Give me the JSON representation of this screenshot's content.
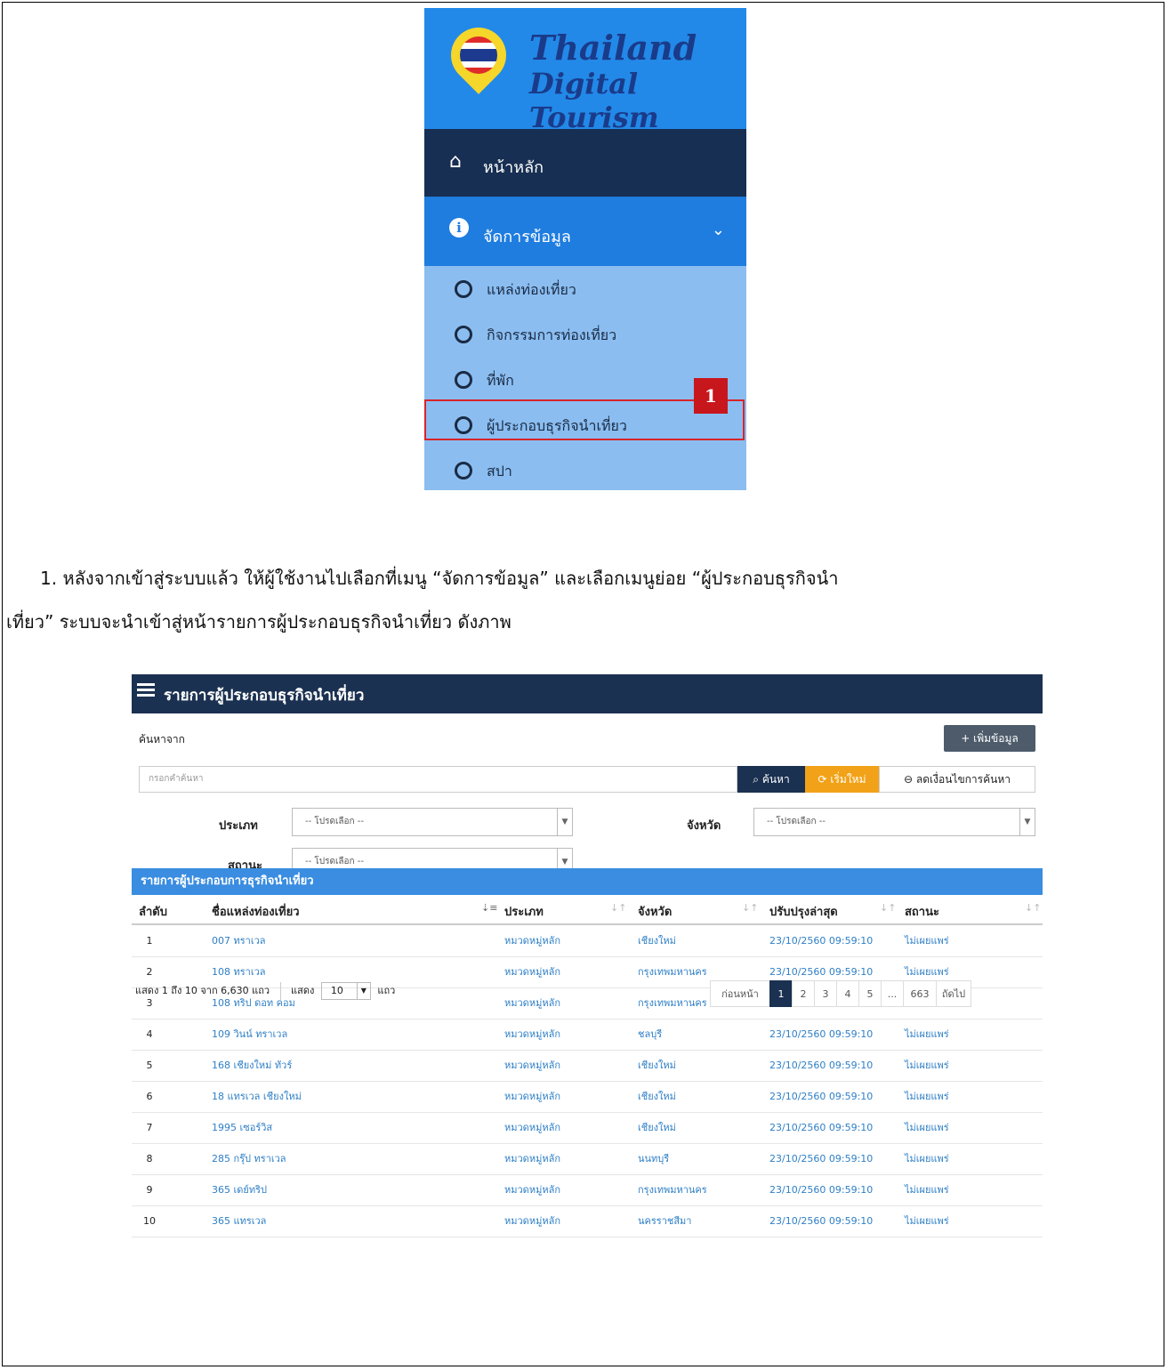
{
  "sidebar": {
    "logo_line1": "Thailand",
    "logo_line2": "Digital Tourism",
    "home": "หน้าหลัก",
    "manage": "จัดการข้อมูล",
    "items": [
      "แหล่งท่องเที่ยว",
      "กิจกรรมการท่องเที่ยว",
      "ที่พัก",
      "ผู้ประกอบธุรกิจนำเที่ยว",
      "สปา"
    ],
    "badge": "1"
  },
  "paragraph": {
    "line1": "1. หลังจากเข้าสู่ระบบแล้ว ให้ผู้ใช้งานไปเลือกที่เมนู “จัดการข้อมูล” และเลือกเมนูย่อย “ผู้ประกอบธุรกิจนำ",
    "line2": "เที่ยว” ระบบจะนำเข้าสู่หน้ารายการผู้ประกอบธุรกิจนำเที่ยว ดังภาพ"
  },
  "panel": {
    "title": "รายการผู้ประกอบธุรกิจนำเที่ยว",
    "search_label": "ค้นหาจาก",
    "add_button": "+ เพิ่มข้อมูล",
    "search_placeholder": "กรอกคำค้นหา",
    "search_button": "ค้นหา",
    "reset_button": "เริ่มใหม่",
    "less_button": "ลดเงื่อนไขการค้นหา",
    "filters": {
      "type_label": "ประเภท",
      "province_label": "จังหวัด",
      "status_label": "สถานะ",
      "placeholder": "-- โปรดเลือก --"
    },
    "table_title": "รายการผู้ประกอบการธุรกิจนำเที่ยว",
    "columns": [
      "ลำดับ",
      "ชื่อแหล่งท่องเที่ยว",
      "ประเภท",
      "จังหวัด",
      "ปรับปรุงล่าสุด",
      "สถานะ"
    ],
    "rows": [
      [
        "1",
        "007 ทราเวล",
        "หมวดหมู่หลัก",
        "เชียงใหม่",
        "23/10/2560 09:59:10",
        "ไม่เผยแพร่"
      ],
      [
        "2",
        "108 ทราเวล",
        "หมวดหมู่หลัก",
        "กรุงเทพมหานคร",
        "23/10/2560 09:59:10",
        "ไม่เผยแพร่"
      ],
      [
        "3",
        "108 ทริป ดอท คอม",
        "หมวดหมู่หลัก",
        "กรุงเทพมหานคร",
        "23/10/2560 09:59:10",
        "ไม่เผยแพร่"
      ],
      [
        "4",
        "109 วินน์ ทราเวล",
        "หมวดหมู่หลัก",
        "ชลบุรี",
        "23/10/2560 09:59:10",
        "ไม่เผยแพร่"
      ],
      [
        "5",
        "168 เชียงใหม่ ทัวร์",
        "หมวดหมู่หลัก",
        "เชียงใหม่",
        "23/10/2560 09:59:10",
        "ไม่เผยแพร่"
      ],
      [
        "6",
        "18 แทรเวล เชียงใหม่",
        "หมวดหมู่หลัก",
        "เชียงใหม่",
        "23/10/2560 09:59:10",
        "ไม่เผยแพร่"
      ],
      [
        "7",
        "1995 เซอร์วิส",
        "หมวดหมู่หลัก",
        "เชียงใหม่",
        "23/10/2560 09:59:10",
        "ไม่เผยแพร่"
      ],
      [
        "8",
        "285 กรุ๊ป ทราเวล",
        "หมวดหมู่หลัก",
        "นนทบุรี",
        "23/10/2560 09:59:10",
        "ไม่เผยแพร่"
      ],
      [
        "9",
        "365 เดย์ทริป",
        "หมวดหมู่หลัก",
        "กรุงเทพมหานคร",
        "23/10/2560 09:59:10",
        "ไม่เผยแพร่"
      ],
      [
        "10",
        "365 แทรเวล",
        "หมวดหมู่หลัก",
        "นครราชสีมา",
        "23/10/2560 09:59:10",
        "ไม่เผยแพร่"
      ]
    ],
    "footer": {
      "info": "แสดง 1 ถึง 10 จาก 6,630 แถว",
      "show_label": "แสดง",
      "page_size": "10",
      "rows_label": "แถว"
    },
    "pagination": [
      "ก่อนหน้า",
      "1",
      "2",
      "3",
      "4",
      "5",
      "...",
      "663",
      "ถัดไป"
    ],
    "active_page": "1"
  },
  "colors": {
    "sidebar_logo_bg": "#2289e8",
    "sidebar_dark": "#172f52",
    "sidebar_active": "#1f7de0",
    "sidebar_sub": "#8bbdf0",
    "highlight": "#d8232a",
    "panel_header": "#1b3151",
    "table_title": "#3a8de0",
    "link": "#2e7fc6",
    "reset": "#f2a218"
  }
}
